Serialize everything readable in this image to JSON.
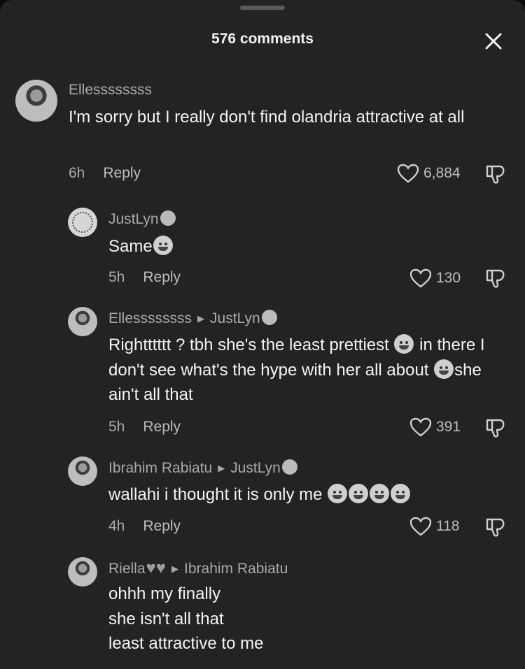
{
  "header": {
    "title": "576 comments"
  },
  "comments": [
    {
      "user": "Ellessssssss",
      "text": "I'm sorry but I really don't find olandria attractive at all",
      "time": "6h",
      "reply": "Reply",
      "likes": "6,884"
    },
    {
      "user": "JustLyn",
      "text": "Same",
      "time": "5h",
      "reply": "Reply",
      "likes": "130"
    },
    {
      "user": "Ellessssssss",
      "reply_to": "JustLyn",
      "text_a": "Rightttttt ? tbh she's the least prettiest",
      "text_b": "in there I don't see what's the hype with her all about",
      "text_c": "she ain't all that",
      "time": "5h",
      "reply": "Reply",
      "likes": "391"
    },
    {
      "user": "Ibrahim Rabiatu",
      "reply_to": "JustLyn",
      "text": "wallahi i thought it is only me",
      "time": "4h",
      "reply": "Reply",
      "likes": "118"
    },
    {
      "user": "Riella",
      "reply_to": "Ibrahim Rabiatu",
      "lines": [
        "ohhh my finally",
        "she isn't all that",
        "least attractive to me"
      ]
    }
  ],
  "icons": {
    "close": "close-icon",
    "like": "heart-outline-icon",
    "dislike": "thumbs-down-icon"
  }
}
